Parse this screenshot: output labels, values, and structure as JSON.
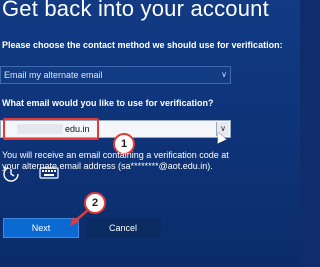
{
  "page": {
    "title": "Get back into your account"
  },
  "method": {
    "label": "Please choose the contact method we should use for verification:",
    "selected": "Email my alternate email"
  },
  "email": {
    "label": "What email would you like to use for verification?",
    "suffix": "edu.in"
  },
  "info": {
    "line1": "You will receive an email containing a verification code at",
    "line2": "your alternate email address (sa********@aot.edu.in)."
  },
  "buttons": {
    "next": "Next",
    "cancel": "Cancel"
  },
  "callouts": {
    "one": "1",
    "two": "2"
  },
  "icons": {
    "accessibility": "ease-of-access-icon",
    "keyboard": "keyboard-icon"
  },
  "colors": {
    "background": "#0f2d6b",
    "next_button": "#0b6ad1",
    "highlight": "#e53935"
  }
}
